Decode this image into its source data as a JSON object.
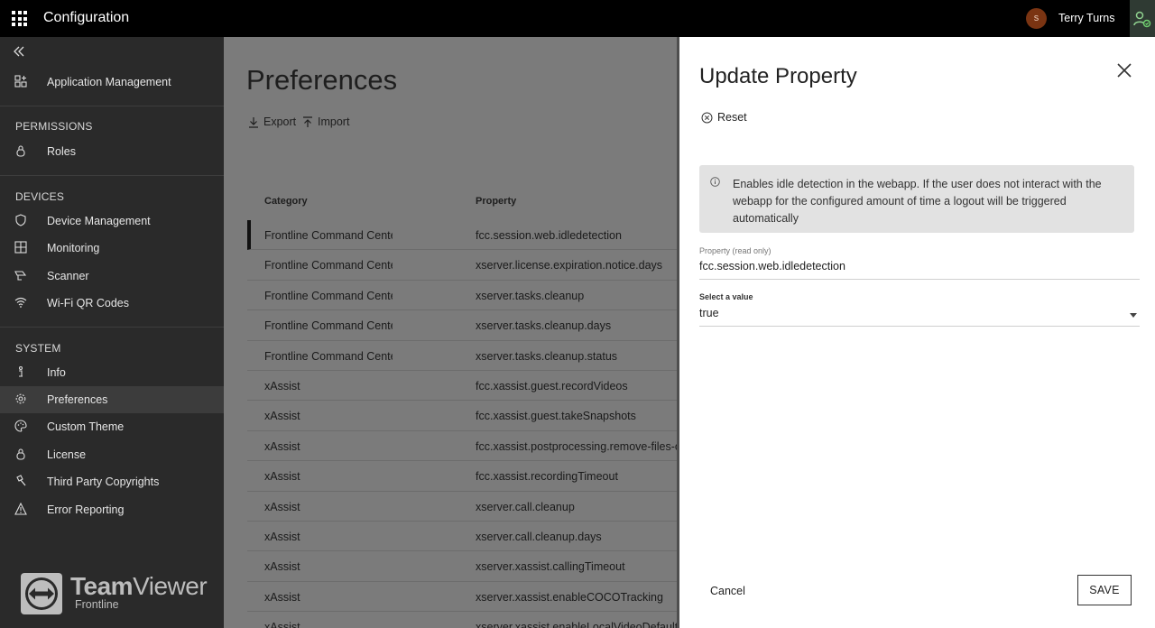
{
  "topbar": {
    "title": "Configuration",
    "user_initial": "s",
    "user_name": "Terry Turns"
  },
  "sidebar": {
    "top_item": "Application Management",
    "sections": [
      {
        "heading": "PERMISSIONS",
        "items": [
          "Roles"
        ]
      },
      {
        "heading": "DEVICES",
        "items": [
          "Device Management",
          "Monitoring",
          "Scanner",
          "Wi-Fi QR Codes"
        ]
      },
      {
        "heading": "SYSTEM",
        "items": [
          "Info",
          "Preferences",
          "Custom Theme",
          "License",
          "Third Party Copyrights",
          "Error Reporting"
        ]
      }
    ],
    "active_item": "Preferences",
    "logo_team": "Team",
    "logo_viewer": "Viewer",
    "logo_sub": "Frontline"
  },
  "main": {
    "title": "Preferences",
    "export_label": "Export",
    "import_label": "Import",
    "columns": [
      "Category",
      "Property"
    ],
    "rows": [
      [
        "Frontline Command Center",
        "fcc.session.web.idledetection"
      ],
      [
        "Frontline Command Center",
        "xserver.license.expiration.notice.days"
      ],
      [
        "Frontline Command Center",
        "xserver.tasks.cleanup"
      ],
      [
        "Frontline Command Center",
        "xserver.tasks.cleanup.days"
      ],
      [
        "Frontline Command Center",
        "xserver.tasks.cleanup.status"
      ],
      [
        "xAssist",
        "fcc.xassist.guest.recordVideos"
      ],
      [
        "xAssist",
        "fcc.xassist.guest.takeSnapshots"
      ],
      [
        "xAssist",
        "fcc.xassist.postprocessing.remove-files-o"
      ],
      [
        "xAssist",
        "fcc.xassist.recordingTimeout"
      ],
      [
        "xAssist",
        "xserver.call.cleanup"
      ],
      [
        "xAssist",
        "xserver.call.cleanup.days"
      ],
      [
        "xAssist",
        "xserver.xassist.callingTimeout"
      ],
      [
        "xAssist",
        "xserver.xassist.enableCOCOTracking"
      ],
      [
        "xAssist",
        "xserver.xassist.enableLocalVideoDefault"
      ]
    ]
  },
  "panel": {
    "title": "Update Property",
    "reset_label": "Reset",
    "info_text": "Enables idle detection in the webapp. If the user does not interact with the webapp for the configured amount of time a logout will be triggered automatically",
    "property_label": "Property (read only)",
    "property_value": "fcc.session.web.idledetection",
    "select_label": "Select a value",
    "select_value": "true",
    "cancel_label": "Cancel",
    "save_label": "SAVE"
  }
}
